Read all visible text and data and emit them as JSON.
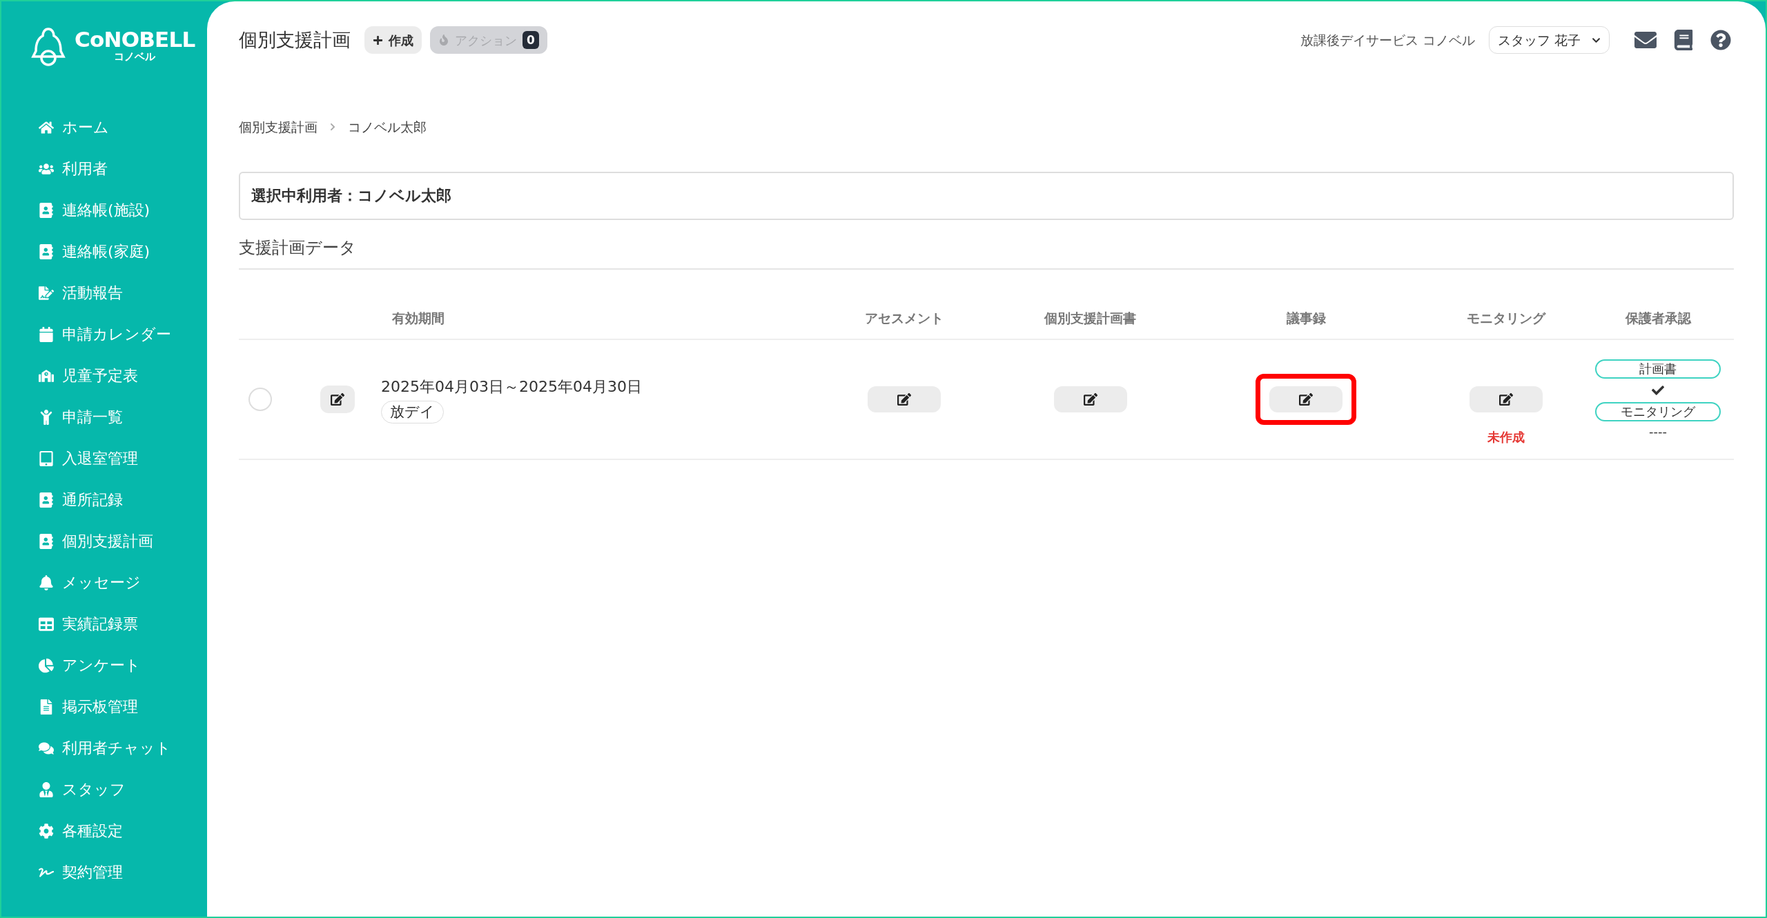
{
  "logo": {
    "name": "CoNOBELL",
    "subtitle": "コノベル"
  },
  "sidebar": {
    "items": [
      {
        "label": "ホーム"
      },
      {
        "label": "利用者"
      },
      {
        "label": "連絡帳(施設)"
      },
      {
        "label": "連絡帳(家庭)"
      },
      {
        "label": "活動報告"
      },
      {
        "label": "申請カレンダー"
      },
      {
        "label": "児童予定表"
      },
      {
        "label": "申請一覧"
      },
      {
        "label": "入退室管理"
      },
      {
        "label": "通所記録"
      },
      {
        "label": "個別支援計画"
      },
      {
        "label": "メッセージ"
      },
      {
        "label": "実績記録票"
      },
      {
        "label": "アンケート"
      },
      {
        "label": "掲示板管理"
      },
      {
        "label": "利用者チャット"
      },
      {
        "label": "スタッフ"
      },
      {
        "label": "各種設定"
      },
      {
        "label": "契約管理"
      }
    ]
  },
  "header": {
    "title": "個別支援計画",
    "create_button": "作成",
    "action_button": {
      "label": "アクション",
      "count": "0",
      "disabled": true
    },
    "facility": "放課後デイサービス コノベル",
    "user_select": "スタッフ 花子"
  },
  "breadcrumb": [
    "個別支援計画",
    "コノベル太郎"
  ],
  "selected_user": "選択中利用者：コノベル太郎",
  "section_title": "支援計画データ",
  "table": {
    "columns": [
      "有効期間",
      "アセスメント",
      "個別支援計画書",
      "議事録",
      "モニタリング",
      "保護者承認"
    ],
    "rows": [
      {
        "checked": false,
        "period": "2025年04月03日～2025年04月30日",
        "tag": "放デイ",
        "documents": [
          {
            "kind": "edit"
          },
          {
            "kind": "edit"
          },
          {
            "kind": "edit",
            "highlighted": true
          },
          {
            "kind": "edit",
            "note": "未作成"
          }
        ],
        "approvals": [
          {
            "label": "計画書",
            "approved": true
          },
          {
            "label": "モニタリング",
            "approved": false,
            "status": "----"
          }
        ]
      }
    ]
  }
}
